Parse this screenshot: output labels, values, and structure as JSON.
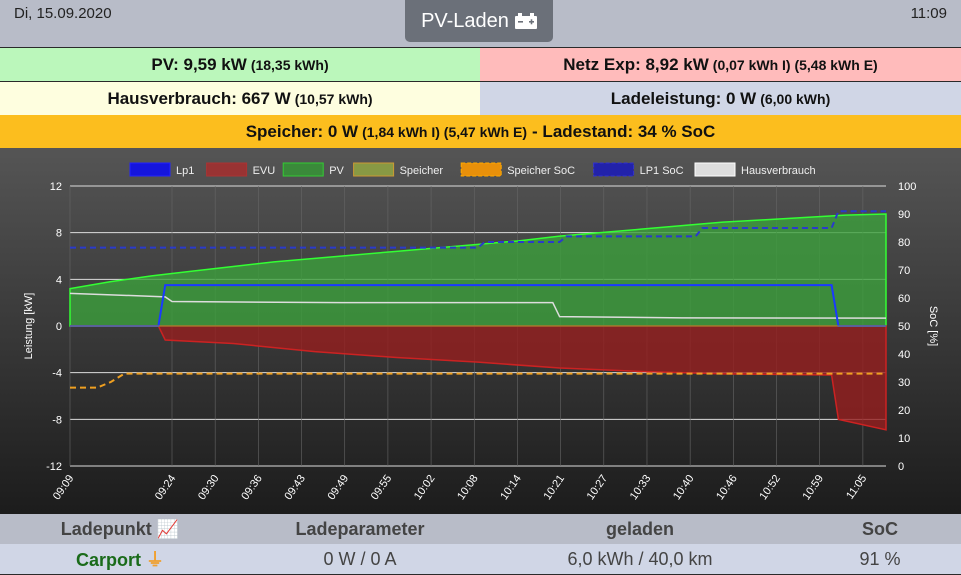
{
  "header": {
    "date": "Di, 15.09.2020",
    "time": "11:09",
    "mode": "PV-Laden",
    "mode_icon": "car-battery-icon"
  },
  "status": {
    "pv": {
      "main": "PV: 9,59 kW",
      "sub": "(18,35 kWh)",
      "color": "#bbf7bb"
    },
    "netz": {
      "main": "Netz Exp: 8,92 kW",
      "sub": "(0,07 kWh I) (5,48 kWh E)",
      "color": "#ffbbbb"
    },
    "haus": {
      "main": "Hausverbrauch: 667 W",
      "sub": "(10,57 kWh)",
      "color": "#fefedf"
    },
    "lade": {
      "main": "Ladeleistung: 0 W",
      "sub": "(6,00 kWh)",
      "color": "#d0d6e6"
    },
    "speicher": {
      "main": "Speicher: 0 W",
      "sub": "(1,84 kWh I) (5,47 kWh E)",
      "tail": "- Ladestand: 34 % SoC",
      "color": "#fcbe1e"
    }
  },
  "chart_data": {
    "type": "line",
    "legend": [
      "Lp1",
      "EVU",
      "PV",
      "Speicher",
      "Speicher SoC",
      "LP1 SoC",
      "Hausverbrauch"
    ],
    "ylabel": "Leistung [kW]",
    "y2label": "SoC [%]",
    "ylim": [
      -12,
      12
    ],
    "y2lim": [
      0,
      100
    ],
    "yticks": [
      12,
      8,
      4,
      0,
      -4,
      -8,
      -12
    ],
    "y2ticks": [
      100,
      90,
      80,
      70,
      60,
      50,
      40,
      30,
      20,
      10,
      0
    ],
    "xticks": [
      "09:09",
      "09:24",
      "09:30",
      "09:36",
      "09:43",
      "09:49",
      "09:55",
      "10:02",
      "10:08",
      "10:14",
      "10:21",
      "10:27",
      "10:33",
      "10:40",
      "10:46",
      "10:52",
      "10:59",
      "11:05"
    ],
    "xlim_minutes_after_0909": [
      0,
      120
    ],
    "series": {
      "PV": [
        [
          0,
          3.2
        ],
        [
          6,
          3.8
        ],
        [
          12,
          4.3
        ],
        [
          18,
          4.7
        ],
        [
          24,
          5.1
        ],
        [
          30,
          5.5
        ],
        [
          36,
          5.8
        ],
        [
          42,
          6.1
        ],
        [
          48,
          6.4
        ],
        [
          54,
          6.7
        ],
        [
          60,
          7
        ],
        [
          66,
          7.3
        ],
        [
          72,
          7.7
        ],
        [
          78,
          8
        ],
        [
          84,
          8.3
        ],
        [
          90,
          8.6
        ],
        [
          96,
          8.9
        ],
        [
          102,
          9.1
        ],
        [
          108,
          9.3
        ],
        [
          114,
          9.5
        ],
        [
          120,
          9.6
        ]
      ],
      "Hausverbrauch": [
        [
          0,
          2.8
        ],
        [
          14,
          2.5
        ],
        [
          15,
          2.1
        ],
        [
          40,
          2
        ],
        [
          60,
          2
        ],
        [
          71,
          2
        ],
        [
          72,
          0.8
        ],
        [
          90,
          0.7
        ],
        [
          120,
          0.67
        ]
      ],
      "Lp1": [
        [
          0,
          0
        ],
        [
          13,
          0
        ],
        [
          14,
          3.5
        ],
        [
          112,
          3.5
        ],
        [
          113,
          0
        ],
        [
          120,
          0
        ]
      ],
      "EVU": [
        [
          0,
          0
        ],
        [
          13,
          0
        ],
        [
          14,
          -1.2
        ],
        [
          24,
          -1.5
        ],
        [
          36,
          -2.2
        ],
        [
          48,
          -2.7
        ],
        [
          60,
          -3.1
        ],
        [
          72,
          -3.6
        ],
        [
          84,
          -3.9
        ],
        [
          96,
          -4.1
        ],
        [
          112,
          -4.2
        ],
        [
          113,
          -8
        ],
        [
          120,
          -8.9
        ]
      ],
      "Speicher": [
        [
          0,
          0
        ],
        [
          120,
          0
        ]
      ],
      "Speicher SoC": [
        [
          0,
          28
        ],
        [
          4,
          28
        ],
        [
          6,
          30
        ],
        [
          8,
          33
        ],
        [
          120,
          33
        ]
      ],
      "LP1 SoC": [
        [
          0,
          78
        ],
        [
          60,
          78
        ],
        [
          61,
          80
        ],
        [
          72,
          80
        ],
        [
          73,
          82
        ],
        [
          92,
          82
        ],
        [
          93,
          85
        ],
        [
          112,
          85
        ],
        [
          113,
          91
        ],
        [
          120,
          91
        ]
      ]
    }
  },
  "table": {
    "headers": [
      "Ladepunkt",
      "Ladeparameter",
      "geladen",
      "SoC"
    ],
    "row": {
      "name": "Carport",
      "params": "0 W / 0 A",
      "charged": "6,0 kWh / 40,0 km",
      "soc": "91 %"
    }
  }
}
